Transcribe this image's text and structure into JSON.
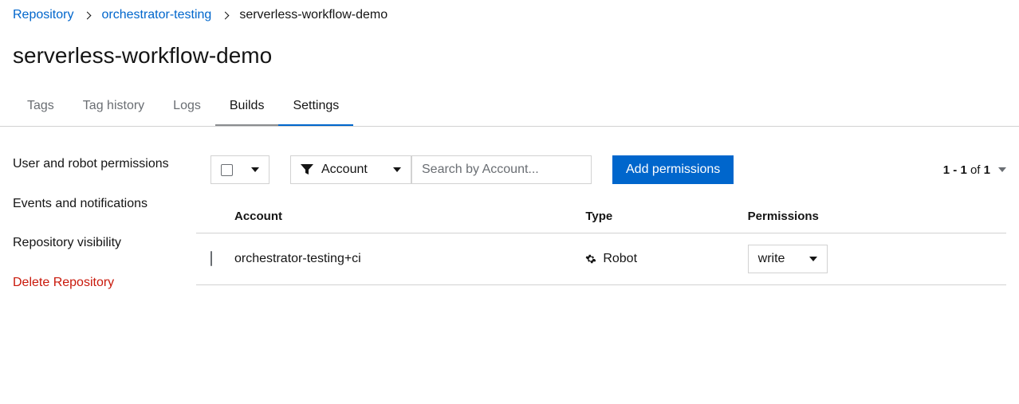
{
  "breadcrumb": {
    "root": "Repository",
    "org": "orchestrator-testing",
    "repo": "serverless-workflow-demo"
  },
  "page_title": "serverless-workflow-demo",
  "tabs": {
    "tags": "Tags",
    "tag_history": "Tag history",
    "logs": "Logs",
    "builds": "Builds",
    "settings": "Settings"
  },
  "sidemenu": {
    "permissions": "User and robot permissions",
    "events": "Events and notifications",
    "visibility": "Repository visibility",
    "delete": "Delete Repository"
  },
  "toolbar": {
    "filter_label": "Account",
    "search_placeholder": "Search by Account...",
    "add_button": "Add permissions",
    "pagination": {
      "range": "1 - 1",
      "of_word": "of",
      "total": "1"
    }
  },
  "table": {
    "columns": {
      "account": "Account",
      "type": "Type",
      "permissions": "Permissions"
    },
    "rows": [
      {
        "account": "orchestrator-testing+ci",
        "type": "Robot",
        "permission": "write"
      }
    ]
  }
}
